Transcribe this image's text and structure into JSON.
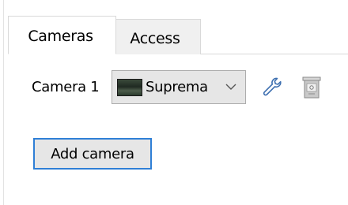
{
  "tabs": [
    {
      "label": "Cameras",
      "active": true
    },
    {
      "label": "Access",
      "active": false
    }
  ],
  "camera": {
    "label": "Camera 1",
    "selected": "Suprema"
  },
  "actions": {
    "add_label": "Add camera"
  },
  "icons": {
    "settings": "wrench-icon",
    "delete": "trash-icon",
    "dropdown": "chevron-down-icon"
  },
  "colors": {
    "focus_border": "#2f7fd6",
    "button_face": "#e6e6e6",
    "tab_inactive": "#f0f0f0",
    "border": "#d9d9d9"
  }
}
